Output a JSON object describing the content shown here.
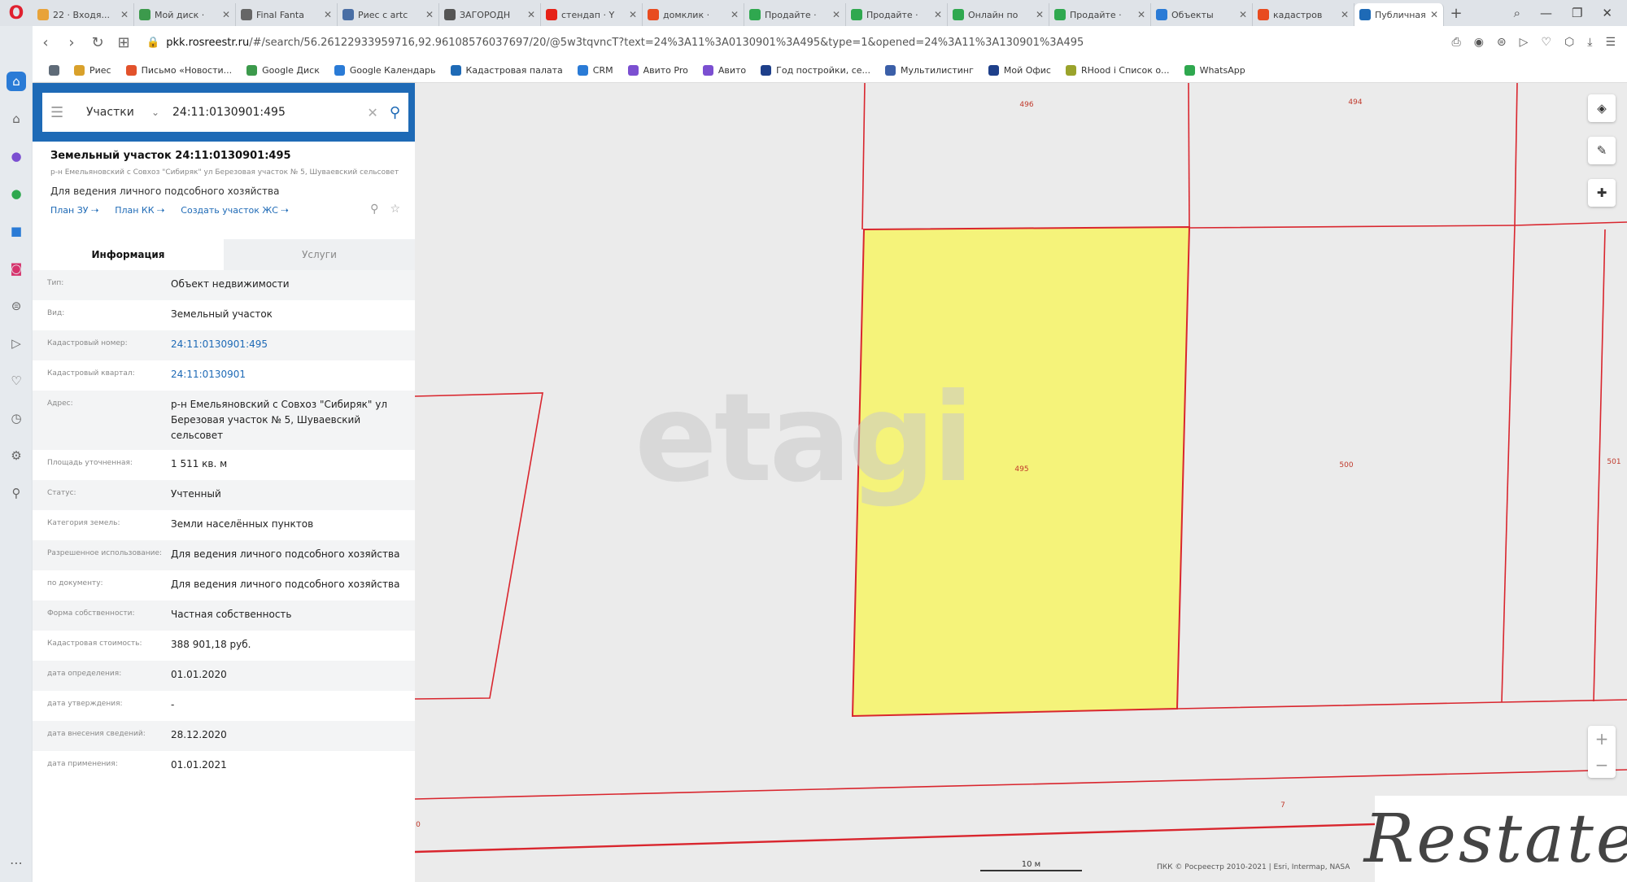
{
  "browser": {
    "tabs": [
      {
        "title": "22 · Входя...",
        "color": "#e8a33a",
        "active": false
      },
      {
        "title": "Мой диск ·",
        "color": "#3c9a4c",
        "active": false
      },
      {
        "title": "Final Fanta",
        "color": "#666666",
        "active": false
      },
      {
        "title": "Риес с artc",
        "color": "#4a6fa5",
        "active": false
      },
      {
        "title": "ЗАГОРОДН",
        "color": "#555555",
        "active": false
      },
      {
        "title": "стендап · Y",
        "color": "#e62117",
        "active": false
      },
      {
        "title": "домклик ·",
        "color": "#e84b1f",
        "active": false
      },
      {
        "title": "Продайте ·",
        "color": "#2fa84f",
        "active": false
      },
      {
        "title": "Продайте ·",
        "color": "#2fa84f",
        "active": false
      },
      {
        "title": "Онлайн по",
        "color": "#2fa84f",
        "active": false
      },
      {
        "title": "Продайте ·",
        "color": "#2fa84f",
        "active": false
      },
      {
        "title": "Объекты",
        "color": "#2a7bd6",
        "active": false
      },
      {
        "title": "кадастров",
        "color": "#e84b1f",
        "active": false
      },
      {
        "title": "Публичная",
        "color": "#1e6ab6",
        "active": true
      }
    ],
    "url_host": "pkk.rosreestr.ru",
    "url_rest": "/#/search/56.26122933959716,92.96108576037697/20/@5w3tqvncT?text=24%3A11%3A0130901%3A495&type=1&opened=24%3A11%3A130901%3A495",
    "bookmarks": [
      {
        "label": "Риес",
        "color": "#d9a12b"
      },
      {
        "label": "Письмо «Новости...",
        "color": "#e2522b"
      },
      {
        "label": "Google Диск",
        "color": "#3c9a4c"
      },
      {
        "label": "Google Календарь",
        "color": "#2a7bd6"
      },
      {
        "label": "Кадастровая палата",
        "color": "#1e6ab6"
      },
      {
        "label": "CRM",
        "color": "#2a7bd6"
      },
      {
        "label": "Авито Pro",
        "color": "#7b4fd1"
      },
      {
        "label": "Авито",
        "color": "#7b4fd1"
      },
      {
        "label": "Год постройки, се...",
        "color": "#1e3f8a"
      },
      {
        "label": "Мультилистинг",
        "color": "#3b5fa8"
      },
      {
        "label": "Мой Офис",
        "color": "#1e3f8a"
      },
      {
        "label": "RHood i Список о...",
        "color": "#9aa32b"
      },
      {
        "label": "WhatsApp",
        "color": "#2fa84f"
      }
    ]
  },
  "search": {
    "type": "Участки",
    "value": "24:11:0130901:495"
  },
  "parcel": {
    "title": "Земельный участок 24:11:0130901:495",
    "address_short": "р-н Емельяновский с Совхоз \"Сибиряк\" ул Березовая участок № 5, Шуваевский сельсовет",
    "use": "Для ведения личного подсобного хозяйства",
    "links": [
      "План ЗУ ⇢",
      "План КК ⇢",
      "Создать участок ЖС ⇢"
    ]
  },
  "panel_tabs": [
    "Информация",
    "Услуги"
  ],
  "info_rows": [
    {
      "label": "Тип:",
      "value": "Объект недвижимости",
      "link": false
    },
    {
      "label": "Вид:",
      "value": "Земельный участок",
      "link": false
    },
    {
      "label": "Кадастровый номер:",
      "value": "24:11:0130901:495",
      "link": true
    },
    {
      "label": "Кадастровый квартал:",
      "value": "24:11:0130901",
      "link": true
    },
    {
      "label": "Адрес:",
      "value": "р-н Емельяновский с Совхоз \"Сибиряк\" ул Березовая участок № 5, Шуваевский сельсовет",
      "link": false
    },
    {
      "label": "Площадь уточненная:",
      "value": "1 511 кв. м",
      "link": false
    },
    {
      "label": "Статус:",
      "value": "Учтенный",
      "link": false
    },
    {
      "label": "Категория земель:",
      "value": "Земли населённых пунктов",
      "link": false
    },
    {
      "label": "Разрешенное использование:",
      "value": "Для ведения личного подсобного хозяйства",
      "link": false
    },
    {
      "label": "по документу:",
      "value": "Для ведения личного подсобного хозяйства",
      "link": false
    },
    {
      "label": "Форма собственности:",
      "value": "Частная собственность",
      "link": false
    },
    {
      "label": "Кадастровая стоимость:",
      "value": "388 901,18 руб.",
      "link": false
    },
    {
      "label": "дата определения:",
      "value": "01.01.2020",
      "link": false
    },
    {
      "label": "дата утверждения:",
      "value": "-",
      "link": false
    },
    {
      "label": "дата внесения сведений:",
      "value": "28.12.2020",
      "link": false
    },
    {
      "label": "дата применения:",
      "value": "01.01.2021",
      "link": false
    }
  ],
  "map": {
    "plot_labels": {
      "p495": "495",
      "p496": "496",
      "p494": "494",
      "p500": "500",
      "p501": "501",
      "p7": "7",
      "p0": "0"
    },
    "watermark": "etagi",
    "scale": "10 м",
    "attribution": "ПКК © Росреестр 2010-2021 | Esri, Intermap, NASA",
    "highlight_color": "#f5f37a",
    "boundary_color": "#d9262e"
  },
  "brand_watermark": "Restate"
}
